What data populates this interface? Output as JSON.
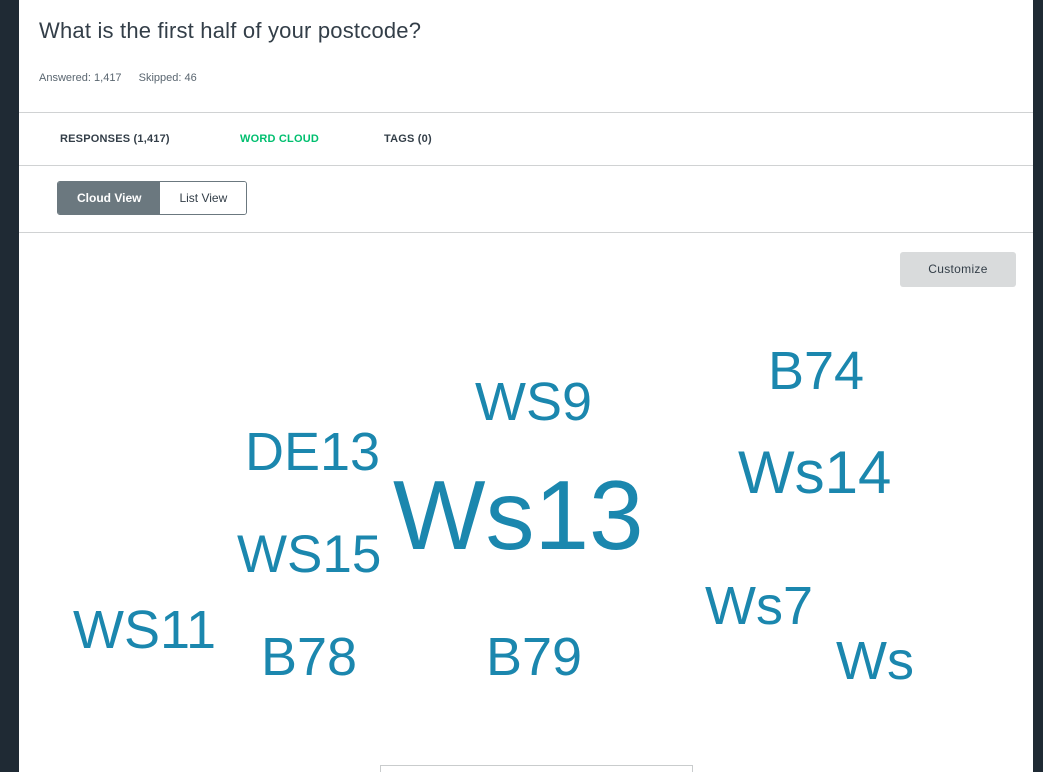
{
  "question": {
    "title": "What is the first half of your postcode?",
    "answered": "Answered: 1,417",
    "skipped": "Skipped: 46"
  },
  "tabs": [
    {
      "label": "RESPONSES (1,417)",
      "active": false
    },
    {
      "label": "WORD CLOUD",
      "active": true
    },
    {
      "label": "TAGS (0)",
      "active": false
    }
  ],
  "view_toggle": {
    "cloud_label": "Cloud View",
    "list_label": "List View",
    "selected": "Cloud View"
  },
  "customize_label": "Customize",
  "word_cloud": {
    "color": "#1b87ae",
    "words": [
      "Ws13",
      "WS9",
      "B74",
      "DE13",
      "Ws14",
      "WS15",
      "Ws7",
      "WS11",
      "B78",
      "B79",
      "Ws"
    ]
  },
  "colors": {
    "accent_green": "#00bf6f",
    "toggle_active": "#6b787f",
    "background_dark": "#1f2a34"
  }
}
